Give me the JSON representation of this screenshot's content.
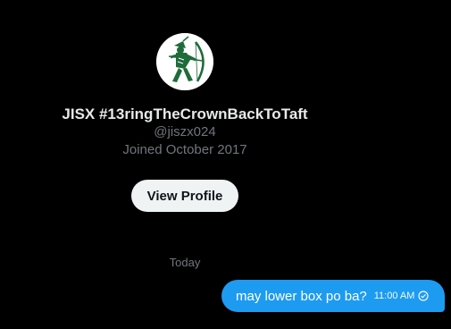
{
  "profile": {
    "display_name": "JISX #13ringTheCrownBackToTaft",
    "handle": "@jiszx024",
    "joined": "Joined October 2017",
    "view_profile_label": "View Profile",
    "avatar_icon": "archer-logo-icon"
  },
  "conversation": {
    "date_separator": "Today",
    "messages": [
      {
        "text": "may lower box po ba?",
        "time": "11:00 AM",
        "status_icon": "sent-check-icon",
        "from_me": true
      }
    ]
  },
  "colors": {
    "background": "#000000",
    "primary_text": "#e7e9ea",
    "secondary_text": "#71767b",
    "bubble": "#1d9bf0",
    "button_bg": "#eff3f4",
    "logo_green": "#1f6b3a"
  }
}
